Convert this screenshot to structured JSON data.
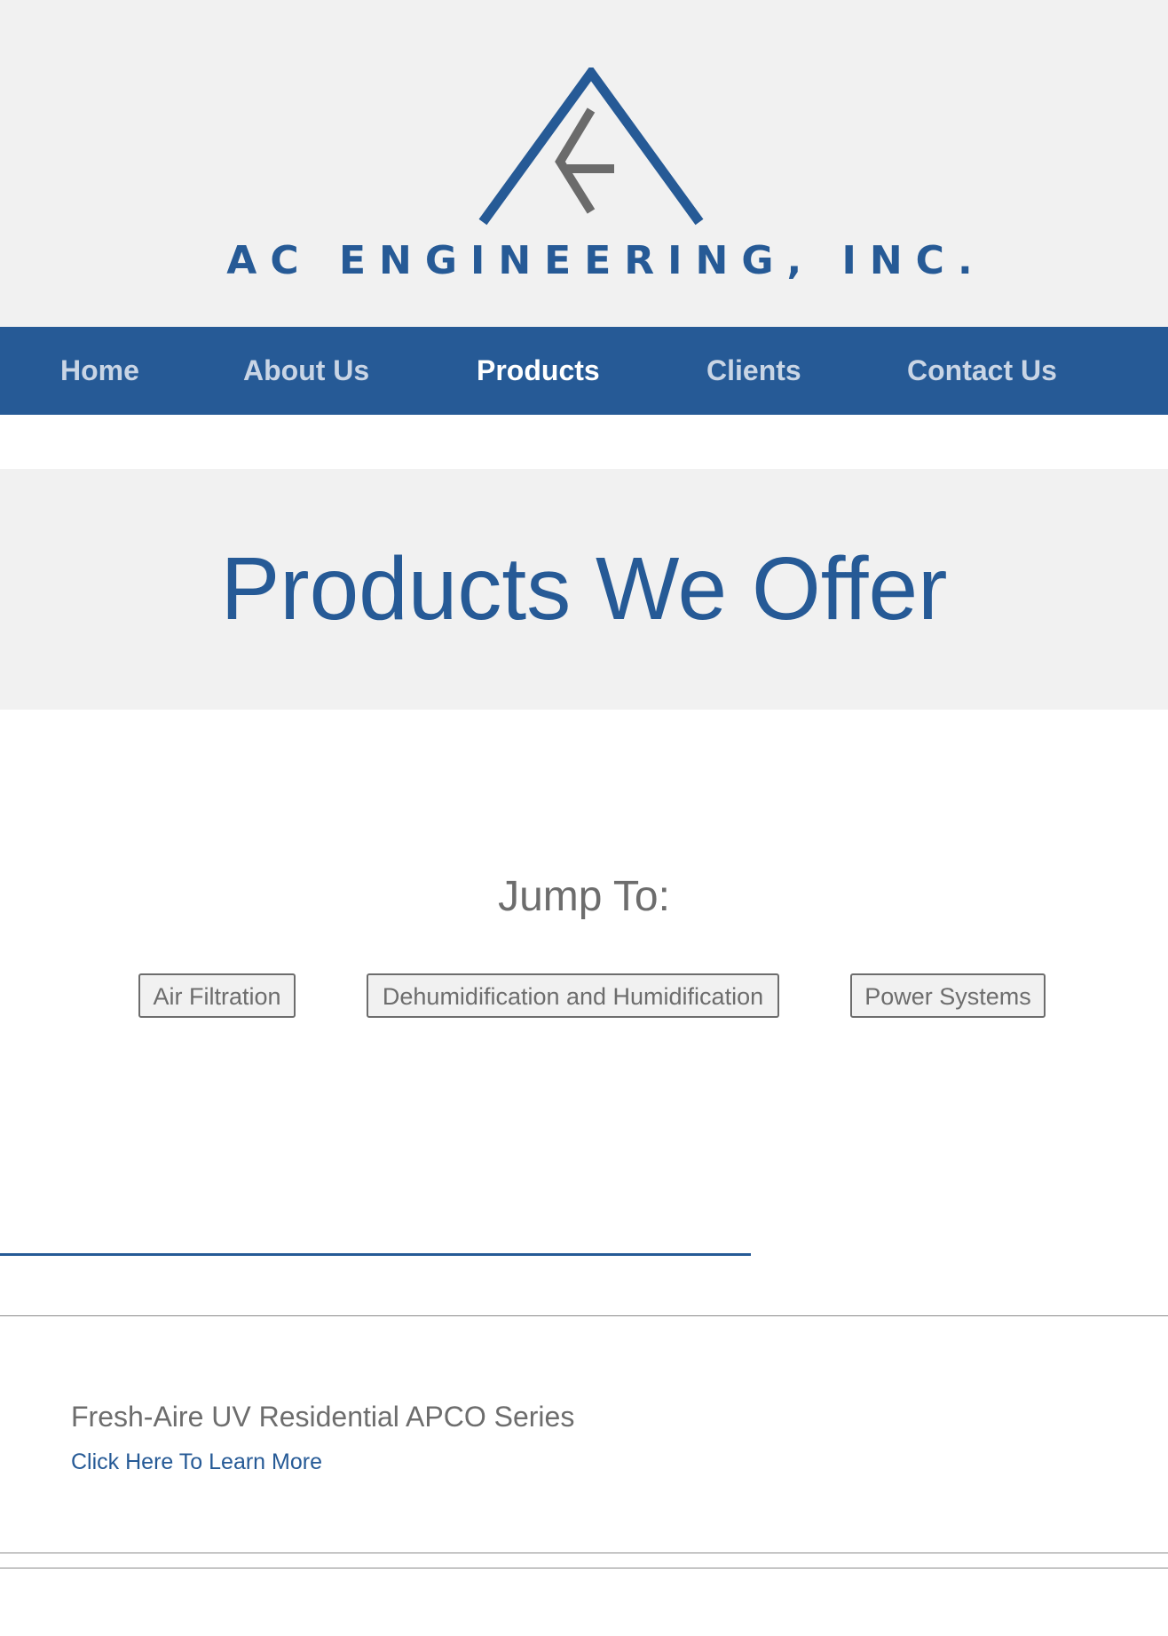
{
  "header": {
    "logo_text": "AC ENGINEERING, INC.",
    "logo_icon": "triangle-arrow-logo",
    "brand_color": "#265a96"
  },
  "nav": {
    "items": [
      {
        "label": "Home"
      },
      {
        "label": "About Us"
      },
      {
        "label": "Products"
      },
      {
        "label": "Clients"
      },
      {
        "label": "Contact Us"
      }
    ],
    "active": "Products"
  },
  "hero": {
    "title": "Products We Offer"
  },
  "jump": {
    "title": "Jump To:",
    "buttons": [
      {
        "label": "Air Filtration"
      },
      {
        "label": "Dehumidification and Humidification"
      },
      {
        "label": "Power Systems"
      }
    ]
  },
  "product": {
    "title": "Fresh-Aire UV Residential APCO Series",
    "link_label": "Click Here To Learn More"
  }
}
